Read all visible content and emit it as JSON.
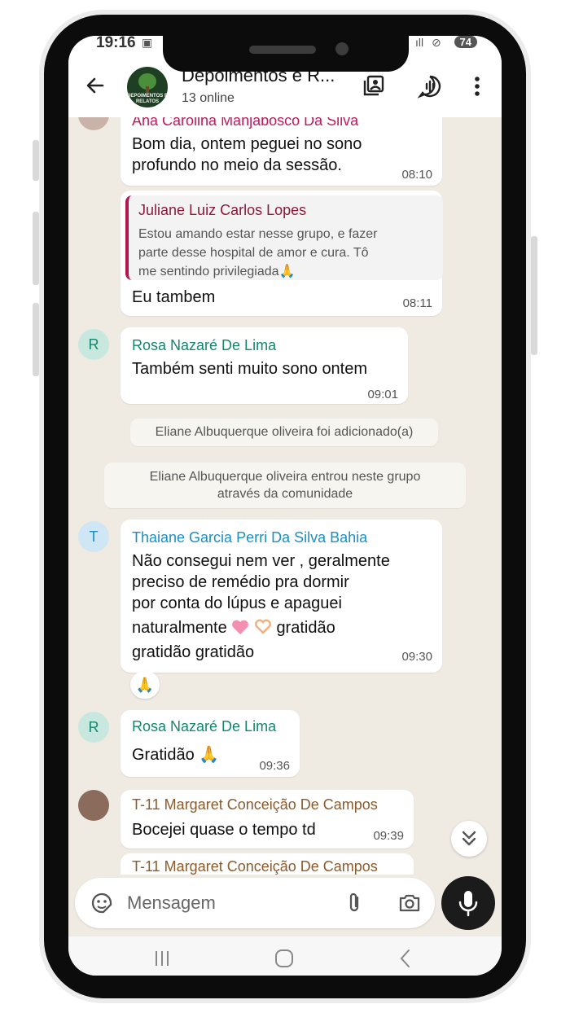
{
  "status_bar": {
    "time": "19:16",
    "battery": "74"
  },
  "header": {
    "back_icon": "arrow-left-icon",
    "group_name": "Depoimentos e R...",
    "group_status": "13 online",
    "avatar_text": "DEPOIMENTOS E RELATOS",
    "icons": [
      "community-icon",
      "voice-chat-icon",
      "more-options-icon"
    ]
  },
  "messages": [
    {
      "sender": "Ana Carolina Manjabosco Da Silva",
      "text_lines": [
        "Bom dia,  ontem peguei no sono",
        "profundo no meio da sessão."
      ],
      "time": "08:10",
      "sender_color": "#c2185b"
    },
    {
      "quote_author": "Juliane Luiz Carlos Lopes",
      "quote_lines": [
        "Estou amando estar nesse grupo, e fazer",
        "parte desse hospital de amor e cura. Tô",
        "me sentindo privilegiada🙏"
      ],
      "text": "Eu tambem",
      "time": "08:11"
    },
    {
      "avatar_letter": "R",
      "sender": "Rosa Nazaré De Lima",
      "text": "Também senti muito sono ontem",
      "time": "09:01",
      "sender_color": "#13866f"
    },
    {
      "avatar_letter": "T",
      "sender": "Thaiane Garcia Perri Da Silva Bahia",
      "text_lines": [
        "Não consegui nem ver , geralmente",
        "preciso de remédio pra dormir",
        "por conta do lúpus e apaguei",
        "naturalmente",
        "gratidão",
        "gratidão gratidão"
      ],
      "time": "09:30",
      "reaction": "🙏",
      "sender_color": "#1a8fc4"
    },
    {
      "avatar_letter": "R",
      "sender": "Rosa Nazaré De Lima",
      "text": "Gratidão 🙏",
      "time": "09:36",
      "sender_color": "#13866f"
    },
    {
      "sender": "T-11 Margaret Conceição De Campos",
      "text": "Bocejei quase o tempo td",
      "time": "09:39",
      "sender_color": "#8d5a2b"
    },
    {
      "sender": "T-11 Margaret Conceição De Campos",
      "sender_color": "#8d5a2b"
    }
  ],
  "system_messages": [
    {
      "text": "Eliane Albuquerque oliveira foi adicionado(a)"
    },
    {
      "lines": [
        "Eliane Albuquerque oliveira entrou neste grupo",
        "através da comunidade"
      ]
    }
  ],
  "input": {
    "placeholder": "Mensagem",
    "icons": [
      "sticker-icon",
      "attach-icon",
      "camera-icon",
      "mic-icon"
    ]
  },
  "nav_icons": [
    "recent-apps-icon",
    "home-icon",
    "back-icon"
  ],
  "colors": {
    "chat_bg": "#efeae2",
    "mic_button": "#1b1b1b"
  }
}
